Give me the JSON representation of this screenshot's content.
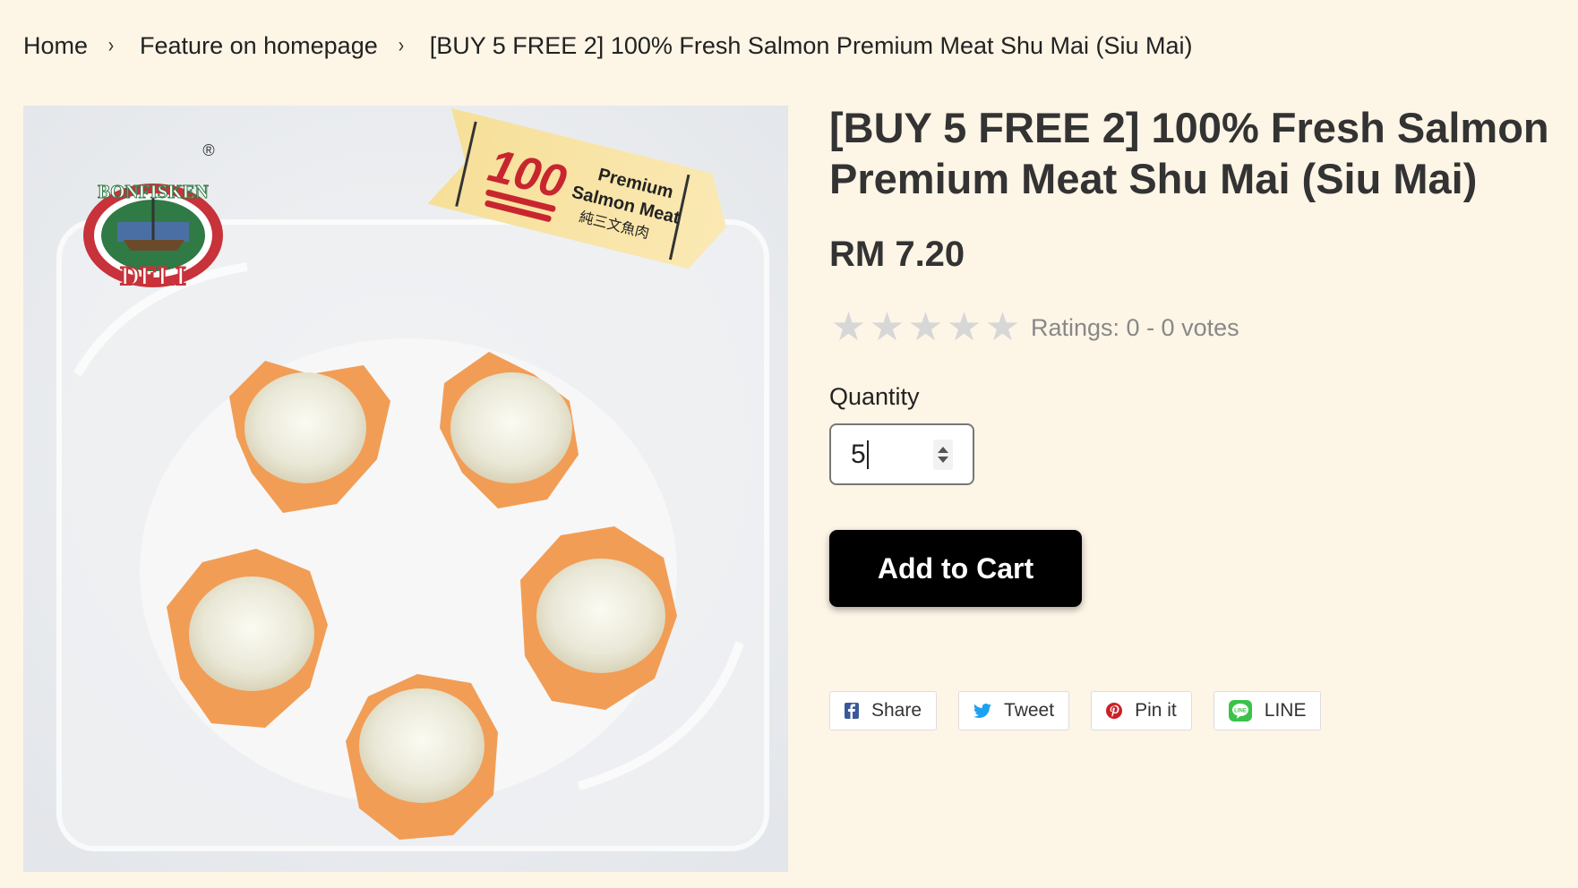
{
  "breadcrumb": {
    "home": "Home",
    "category": "Feature on homepage",
    "current": "[BUY 5 FREE 2] 100% Fresh Salmon Premium Meat Shu Mai (Siu Mai)",
    "separator": "›"
  },
  "product": {
    "title": "[BUY 5 FREE 2] 100% Fresh Salmon Premium Meat Shu Mai (Siu Mai)",
    "price": "RM 7.20",
    "image": {
      "brand_top": "BONFISKEN",
      "brand_bottom": "DELI",
      "registered_mark": "®",
      "banner_number": "100",
      "banner_line1": "Premium",
      "banner_line2": "Salmon Meat",
      "banner_line3": "純三文魚肉"
    }
  },
  "rating": {
    "stars_total": 5,
    "stars_filled": 0,
    "text": "Ratings: 0 - 0 votes"
  },
  "quantity": {
    "label": "Quantity",
    "value": "5"
  },
  "cart": {
    "add_label": "Add to Cart"
  },
  "share": {
    "facebook": "Share",
    "twitter": "Tweet",
    "pinterest": "Pin it",
    "line": "LINE"
  },
  "colors": {
    "page_background": "#fdf5e6",
    "button_background": "#000000",
    "facebook": "#3b5998",
    "twitter": "#1da1f2",
    "pinterest": "#cb2027",
    "line": "#3ac34a",
    "star_empty": "#d7d7d7"
  }
}
